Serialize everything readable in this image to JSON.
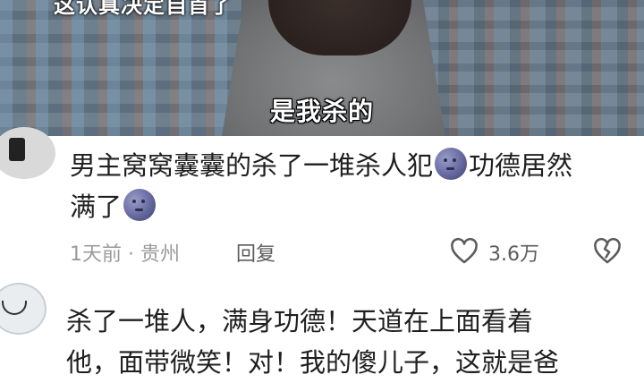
{
  "video": {
    "top_caption": "这认真决定自首了",
    "subtitle": "是我杀的"
  },
  "comments": [
    {
      "line1": "男主窝窝囊囊的杀了一堆杀人犯",
      "line1_end": "功德居然",
      "line2": "满了",
      "emoji_icon": "new-moon-face-icon",
      "meta": "1天前 · 贵州",
      "reply_label": "回复",
      "like_count": "3.6万"
    },
    {
      "line1": "杀了一堆人，满身功德！天道在上面看着",
      "line2": "他，面带微笑！对！我的傻儿子，这就是爸"
    }
  ]
}
